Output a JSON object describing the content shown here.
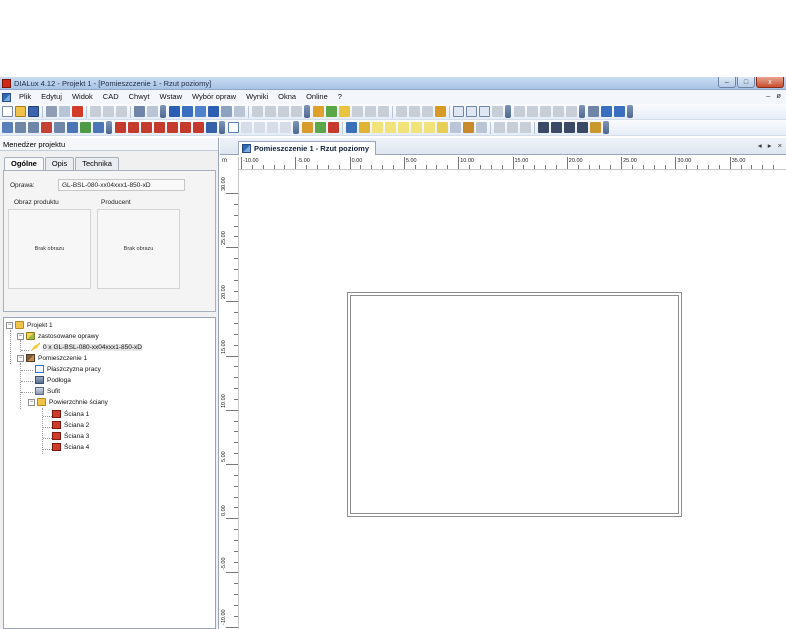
{
  "window": {
    "title": "DIALux 4.12 - Projekt 1 - [Pomieszczenie 1 - Rzut poziomy]",
    "minimize": "–",
    "maximize": "□",
    "close": "x"
  },
  "menu": {
    "items": [
      "Plik",
      "Edytuj",
      "Widok",
      "CAD",
      "Chwyt",
      "Wstaw",
      "Wybór opraw",
      "Wyniki",
      "Okna",
      "Online",
      "?"
    ],
    "right": "–  ø"
  },
  "colors": {
    "titlebar": "#b9d0ed",
    "accent": "#2d6ab5",
    "room_outline": "#8d8d8d"
  },
  "left_panel": {
    "header": "Menedżer projektu",
    "tabs": [
      "Ogólne",
      "Opis",
      "Technika"
    ],
    "active_tab": "Ogólne",
    "oprawa_label": "Oprawa:",
    "oprawa_value": "GL-BSL-080-xx04xxx1-850-xD",
    "product_image_label": "Obraz produktu",
    "producer_label": "Producent",
    "no_image_1": "Brak obrazu",
    "no_image_2": "Brak obrazu"
  },
  "tree": {
    "project": "Projekt 1",
    "used_luminaires": "zastosowane oprawy",
    "luminaire": "0 x GL-BSL-080-xx04xxx1-850-xD",
    "room": "Pomieszczenie 1",
    "work_plane": "Płaszczyzna pracy",
    "floor": "Podłoga",
    "ceiling": "Sufit",
    "wall_surfaces": "Powierzchnie ściany",
    "walls": [
      "Ściana 1",
      "Ściana 2",
      "Ściana 3",
      "Ściana 4"
    ]
  },
  "document": {
    "tab_label": "Pomieszczenie 1 - Rzut poziomy",
    "nav": "◂ ▸ ×",
    "ruler_unit": "m",
    "ruler_top_labels": [
      "-10.00",
      "-5.00",
      "0.00",
      "5.00",
      "10.00",
      "15.00",
      "20.00",
      "25.00",
      "30.00",
      "35.00"
    ],
    "ruler_left_labels": [
      "30.00",
      "25.00",
      "20.00",
      "15.00",
      "10.00",
      "5.00",
      "0.00",
      "-5.00",
      "-10.00"
    ]
  }
}
